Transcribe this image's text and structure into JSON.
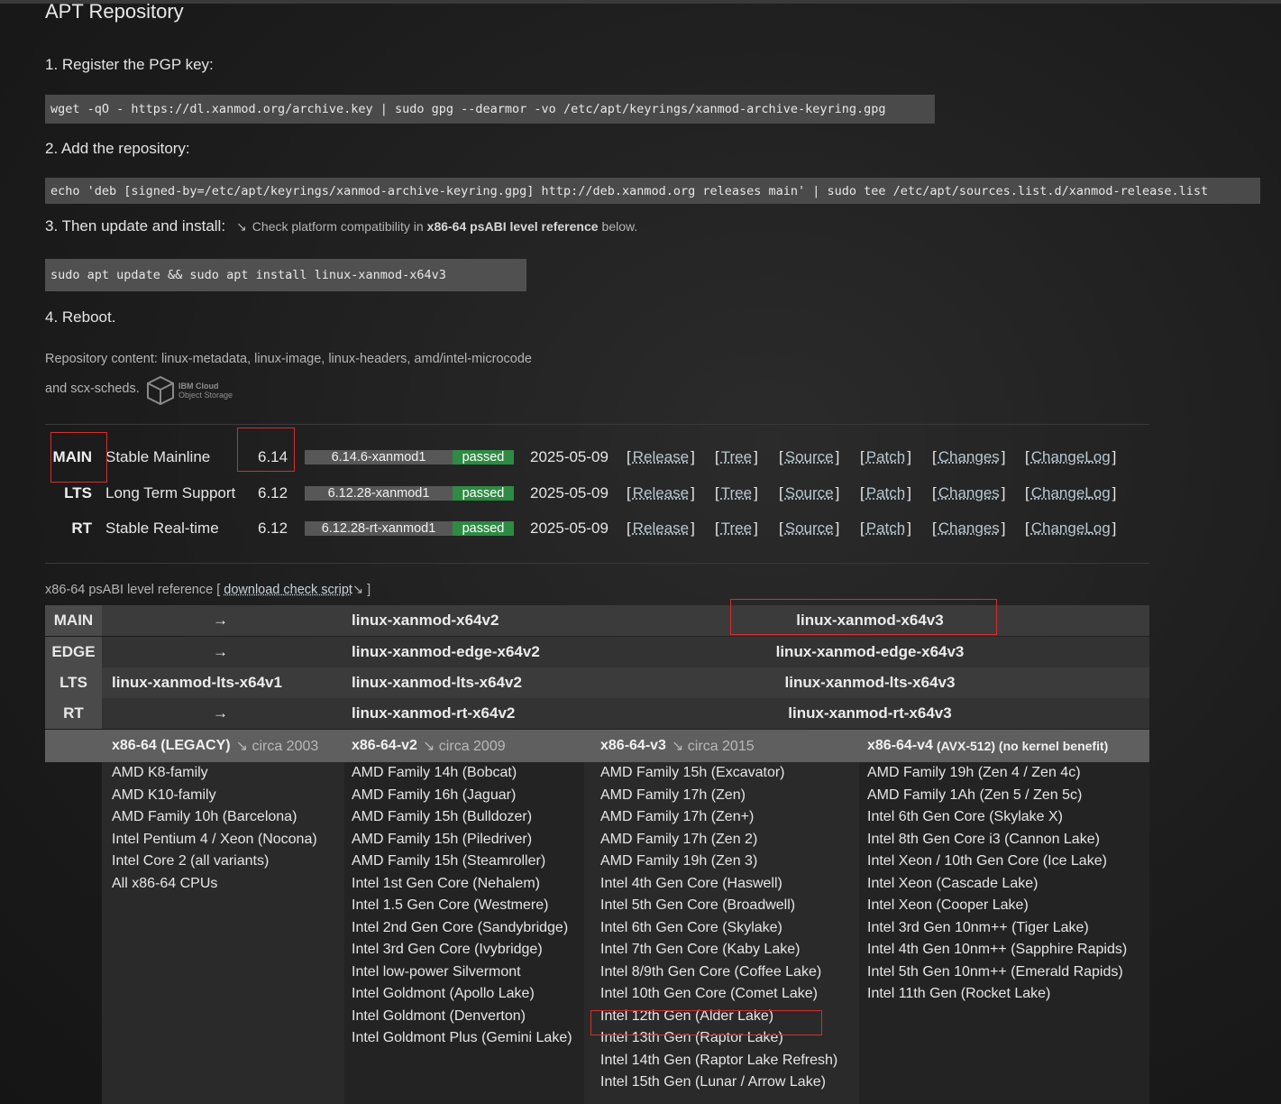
{
  "page": {
    "title": "APT Repository",
    "step1": "1. Register the PGP key:",
    "step1_cmd": "wget -qO - https://dl.xanmod.org/archive.key | sudo gpg --dearmor -vo /etc/apt/keyrings/xanmod-archive-keyring.gpg",
    "step2": "2. Add the repository:",
    "step2_cmd": "echo 'deb [signed-by=/etc/apt/keyrings/xanmod-archive-keyring.gpg] http://deb.xanmod.org releases main' | sudo tee /etc/apt/sources.list.d/xanmod-release.list",
    "step3": "3. Then update and install:",
    "step3_note_pre": "Check platform compatibility in",
    "step3_note_bold": "x86-64 psABI level reference",
    "step3_note_post": "below.",
    "step3_cmd": "sudo apt update && sudo apt install linux-xanmod-x64v3",
    "step4": "4. Reboot.",
    "repo_content_1": "Repository content: linux-metadata, linux-image, linux-headers, amd/intel-microcode",
    "repo_content_2": "and scx-scheds.",
    "ibm_logo_line1": "IBM Cloud",
    "ibm_logo_line2": "Object Storage"
  },
  "releases": [
    {
      "tag": "MAIN",
      "name": "Stable Mainline",
      "version": "6.14",
      "build": "6.14.6-xanmod1",
      "status": "passed",
      "date": "2025-05-09"
    },
    {
      "tag": "LTS",
      "name": "Long Term Support",
      "version": "6.12",
      "build": "6.12.28-xanmod1",
      "status": "passed",
      "date": "2025-05-09"
    },
    {
      "tag": "RT",
      "name": "Stable Real-time",
      "version": "6.12",
      "build": "6.12.28-rt-xanmod1",
      "status": "passed",
      "date": "2025-05-09"
    }
  ],
  "release_links": [
    "Release",
    "Tree",
    "Source",
    "Patch",
    "Changes",
    "ChangeLog"
  ],
  "psabi": {
    "caption_pre": "x86-64 psABI level reference [",
    "caption_link": "download check script",
    "caption_post": "]",
    "rows": [
      {
        "tag": "MAIN",
        "v1": "→",
        "v2": "linux-xanmod-x64v2",
        "v3": "linux-xanmod-x64v3"
      },
      {
        "tag": "EDGE",
        "v1": "→",
        "v2": "linux-xanmod-edge-x64v2",
        "v3": "linux-xanmod-edge-x64v3"
      },
      {
        "tag": "LTS",
        "v1": "linux-xanmod-lts-x64v1",
        "v2": "linux-xanmod-lts-x64v2",
        "v3": "linux-xanmod-lts-x64v3"
      },
      {
        "tag": "RT",
        "v1": "→",
        "v2": "linux-xanmod-rt-x64v2",
        "v3": "linux-xanmod-rt-x64v3"
      }
    ],
    "headers": [
      {
        "name": "x86-64 (LEGACY)",
        "circa": "circa 2003"
      },
      {
        "name": "x86-64-v2",
        "circa": "circa 2009"
      },
      {
        "name": "x86-64-v3",
        "circa": "circa 2015"
      },
      {
        "name": "x86-64-v4",
        "extra": "(AVX-512) (no kernel benefit)"
      }
    ],
    "col_v1": [
      "AMD K8-family",
      "AMD K10-family",
      "AMD Family 10h (Barcelona)",
      "Intel Pentium 4 / Xeon (Nocona)",
      "Intel Core 2 (all variants)",
      "All x86-64 CPUs"
    ],
    "col_v2": [
      "AMD Family 14h (Bobcat)",
      "AMD Family 16h (Jaguar)",
      "AMD Family 15h (Bulldozer)",
      "AMD Family 15h (Piledriver)",
      "AMD Family 15h (Steamroller)",
      "Intel 1st Gen Core (Nehalem)",
      "Intel 1.5 Gen Core (Westmere)",
      "Intel 2nd Gen Core (Sandybridge)",
      "Intel 3rd Gen Core (Ivybridge)",
      "Intel low-power Silvermont",
      "Intel Goldmont (Apollo Lake)",
      "Intel Goldmont (Denverton)",
      "Intel Goldmont Plus (Gemini Lake)"
    ],
    "col_v3": [
      "AMD Family 15h (Excavator)",
      "AMD Family 17h (Zen)",
      "AMD Family 17h (Zen+)",
      "AMD Family 17h (Zen 2)",
      "AMD Family 19h (Zen 3)",
      "Intel 4th Gen Core (Haswell)",
      "Intel 5th Gen Core (Broadwell)",
      "Intel 6th Gen Core (Skylake)",
      "Intel 7th Gen Core (Kaby Lake)",
      "Intel 8/9th Gen Core (Coffee Lake)",
      "Intel 10th Gen Core (Comet Lake)",
      "Intel 12th Gen (Alder Lake)",
      "Intel 13th Gen (Raptor Lake)",
      "Intel 14th Gen (Raptor Lake Refresh)",
      "Intel 15th Gen (Lunar / Arrow Lake)"
    ],
    "col_v4": [
      "AMD Family 19h (Zen 4 / Zen 4c)",
      "AMD Family 1Ah (Zen 5 / Zen 5c)",
      "Intel 6th Gen Core (Skylake X)",
      "Intel 8th Gen Core i3 (Cannon Lake)",
      "Intel Xeon / 10th Gen Core (Ice Lake)",
      "Intel Xeon (Cascade Lake)",
      "Intel Xeon (Cooper Lake)",
      "Intel 3rd Gen 10nm++ (Tiger Lake)",
      "Intel 4th Gen 10nm++ (Sapphire Rapids)",
      "Intel 5th Gen 10nm++ (Emerald Rapids)",
      "Intel 11th Gen (Rocket Lake)"
    ]
  },
  "colors": {
    "passed": "#2e8b43",
    "highlight": "#d32f2f"
  }
}
